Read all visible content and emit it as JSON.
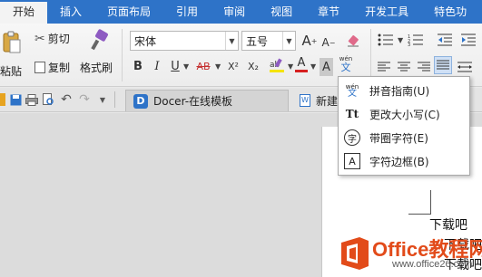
{
  "tabs": [
    "开始",
    "插入",
    "页面布局",
    "引用",
    "审阅",
    "视图",
    "章节",
    "开发工具",
    "特色功"
  ],
  "clipboard": {
    "paste": "粘贴",
    "cut": "剪切",
    "copy": "复制",
    "format_painter": "格式刷"
  },
  "font": {
    "name": "宋体",
    "size": "五号"
  },
  "format_buttons": {
    "bold": "B",
    "italic": "I",
    "underline": "U",
    "strike": "AB",
    "superscript": "X²",
    "subscript": "X₂",
    "font_color": "A",
    "char_shading": "A"
  },
  "quick_access": {
    "docer_tab": "Docer-在线模板",
    "new_tab": "新建"
  },
  "menu": {
    "items": [
      {
        "icon": "wén",
        "label": "拼音指南(U)"
      },
      {
        "icon": "Tt",
        "label": "更改大小写(C)"
      },
      {
        "icon": "字",
        "label": "带圈字符(E)"
      },
      {
        "icon": "A",
        "label": "字符边框(B)"
      }
    ]
  },
  "document": {
    "lines": [
      "下载吧",
      "下载吧",
      "下载吧"
    ]
  },
  "watermark": {
    "title": "Office教程网",
    "url": "www.office26.com"
  },
  "colors": {
    "ribbon_blue": "#2e73c8",
    "highlight_red": "#d62020",
    "watermark_orange": "#e24b1a"
  }
}
